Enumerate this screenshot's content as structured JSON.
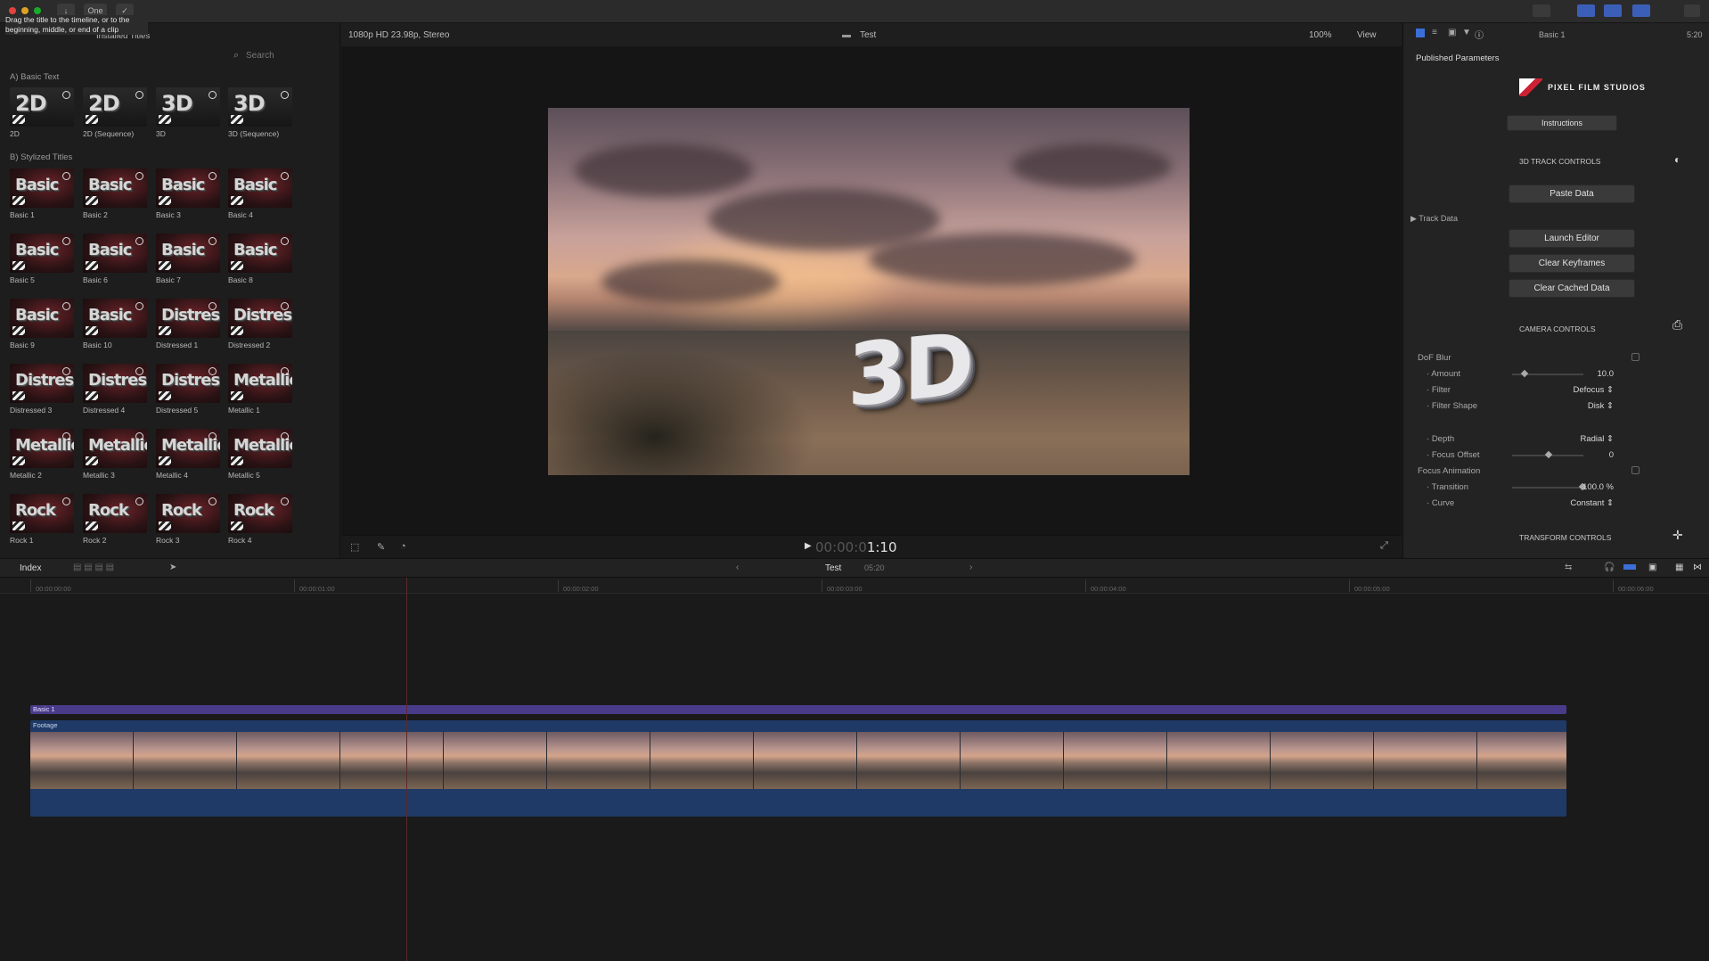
{
  "tooltip": "Drag the title to the timeline, or to the beginning, middle, or end of a clip",
  "toolbar": {
    "one_label": "One"
  },
  "browser": {
    "library_label": "Installed Titles",
    "search_placeholder": "Search",
    "section_a": "A) Basic Text",
    "section_b": "B) Stylized Titles",
    "basic_items": [
      {
        "label": "2D",
        "glyph": "2D"
      },
      {
        "label": "2D (Sequence)",
        "glyph": "2D"
      },
      {
        "label": "3D",
        "glyph": "3D"
      },
      {
        "label": "3D (Sequence)",
        "glyph": "3D"
      }
    ],
    "stylized_items": [
      {
        "label": "Basic 1",
        "glyph": "Basic"
      },
      {
        "label": "Basic 2",
        "glyph": "Basic"
      },
      {
        "label": "Basic 3",
        "glyph": "Basic"
      },
      {
        "label": "Basic 4",
        "glyph": "Basic"
      },
      {
        "label": "Basic 5",
        "glyph": "Basic"
      },
      {
        "label": "Basic 6",
        "glyph": "Basic"
      },
      {
        "label": "Basic 7",
        "glyph": "Basic"
      },
      {
        "label": "Basic 8",
        "glyph": "Basic"
      },
      {
        "label": "Basic 9",
        "glyph": "Basic"
      },
      {
        "label": "Basic 10",
        "glyph": "Basic"
      },
      {
        "label": "Distressed 1",
        "glyph": "Distress"
      },
      {
        "label": "Distressed 2",
        "glyph": "Distress"
      },
      {
        "label": "Distressed 3",
        "glyph": "Distress"
      },
      {
        "label": "Distressed 4",
        "glyph": "Distress"
      },
      {
        "label": "Distressed 5",
        "glyph": "Distress"
      },
      {
        "label": "Metallic 1",
        "glyph": "Metallic"
      },
      {
        "label": "Metallic 2",
        "glyph": "Metallic"
      },
      {
        "label": "Metallic 3",
        "glyph": "Metallic"
      },
      {
        "label": "Metallic 4",
        "glyph": "Metallic"
      },
      {
        "label": "Metallic 5",
        "glyph": "Metallic"
      },
      {
        "label": "Rock 1",
        "glyph": "Rock"
      },
      {
        "label": "Rock 2",
        "glyph": "Rock"
      },
      {
        "label": "Rock 3",
        "glyph": "Rock"
      },
      {
        "label": "Rock 4",
        "glyph": "Rock"
      }
    ]
  },
  "viewer": {
    "format": "1080p HD 23.98p, Stereo",
    "project": "Test",
    "zoom": "100%",
    "view_menu": "View",
    "overlay_text": "3D",
    "timecode_dim": "00:00:0",
    "timecode": "1:10"
  },
  "inspector": {
    "clip_name": "Basic 1",
    "duration": "5:20",
    "published_params": "Published Parameters",
    "brand": "PIXEL FILM STUDIOS",
    "instructions": "Instructions",
    "track_controls": "3D TRACK CONTROLS",
    "paste_data": "Paste Data",
    "track_data": "Track Data",
    "launch_editor": "Launch Editor",
    "clear_keyframes": "Clear Keyframes",
    "clear_cached": "Clear Cached Data",
    "camera_controls": "CAMERA CONTROLS",
    "transform_controls": "TRANSFORM CONTROLS",
    "params": {
      "dof_blur": "DoF Blur",
      "amount": "Amount",
      "amount_val": "10.0",
      "amount_level": 0.15,
      "filter": "Filter",
      "filter_val": "Defocus",
      "filter_shape": "Filter Shape",
      "filter_shape_val": "Disk",
      "depth": "Depth",
      "depth_val": "Radial",
      "focus_offset": "Focus Offset",
      "focus_offset_val": "0",
      "focus_offset_level": 0.5,
      "focus_animation": "Focus Animation",
      "transition": "Transition",
      "transition_val": "100.0",
      "transition_unit": "%",
      "transition_level": 1.0,
      "curve": "Curve",
      "curve_val": "Constant"
    }
  },
  "timeline": {
    "index_label": "Index",
    "project": "Test",
    "project_duration": "05:20",
    "ruler": [
      "00:00:00:00",
      "00:00:01:00",
      "00:00:02:00",
      "00:00:03:00",
      "00:00:04:00",
      "00:00:05:00",
      "00:00:06:00"
    ],
    "title_clip": "Basic 1",
    "footage_clip": "Footage"
  },
  "colors": {
    "title_clip": "#4a3b8a",
    "footage_clip": "#1f3a66",
    "accent_blue": "#3b6fd8"
  }
}
